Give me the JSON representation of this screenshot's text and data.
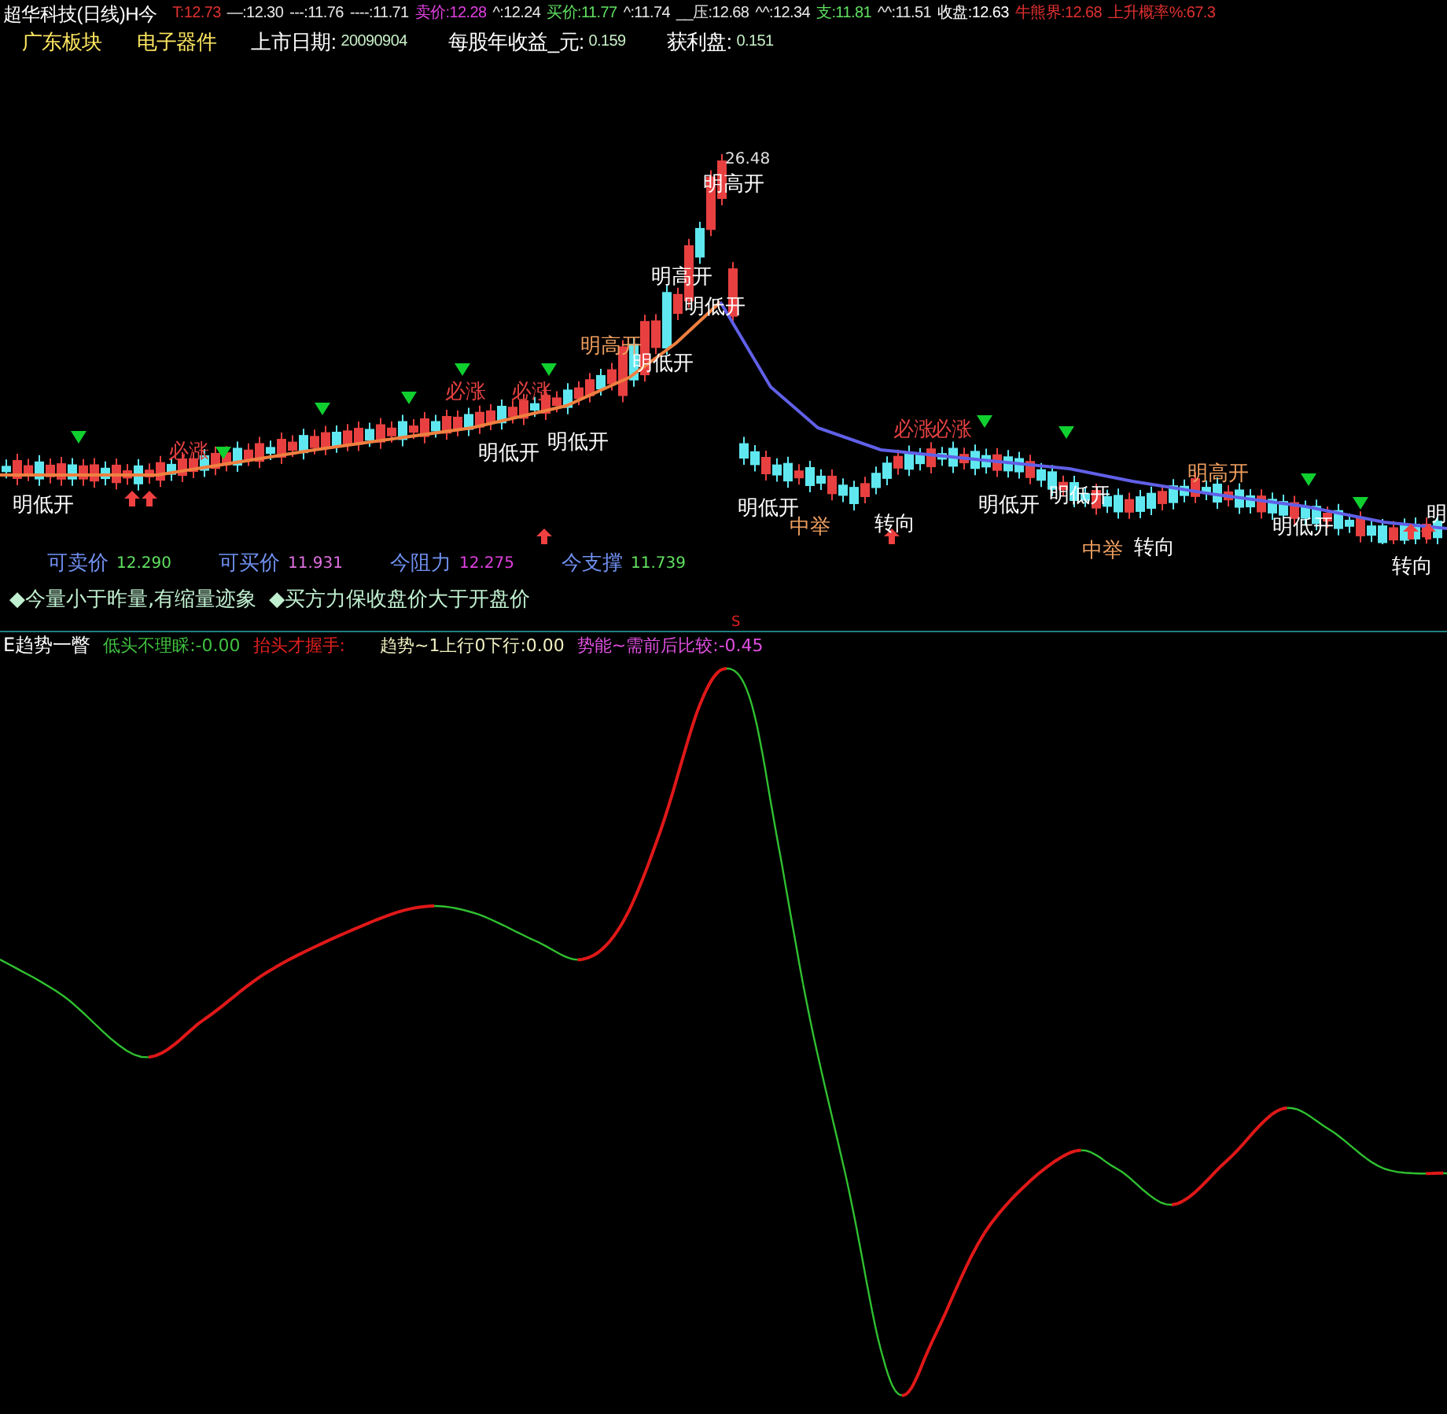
{
  "quote_bar": {
    "title": "超华科技(日线)H今",
    "items": [
      {
        "text": "T:12.73",
        "color": "#e03030"
      },
      {
        "text": "—:12.30",
        "color": "#e8e8e8"
      },
      {
        "text": "---:11.76",
        "color": "#e8e8e8"
      },
      {
        "text": "----:11.71",
        "color": "#e8e8e8"
      },
      {
        "text": "卖价:12.28",
        "color": "#e040e0"
      },
      {
        "text": "^:12.24",
        "color": "#e8e8e8"
      },
      {
        "text": "买价:11.77",
        "color": "#60e060"
      },
      {
        "text": "^:11.74",
        "color": "#e8e8e8"
      },
      {
        "text": "__压:12.68",
        "color": "#e8e8e8"
      },
      {
        "text": "^^:12.34",
        "color": "#e8e8e8"
      },
      {
        "text": "支:11.81",
        "color": "#60e060"
      },
      {
        "text": "^^:11.51",
        "color": "#e8e8e8"
      },
      {
        "text": "收盘:12.63",
        "color": "#ffffff"
      },
      {
        "text": "牛熊界:12.68",
        "color": "#e03030"
      },
      {
        "text": "上升概率%:67.3",
        "color": "#e03030"
      }
    ]
  },
  "info_bar": [
    {
      "label": "广东板块"
    },
    {
      "label": "电子器件"
    },
    {
      "label": "上市日期:",
      "value": "20090904"
    },
    {
      "label": "每股年收益_元:",
      "value": "0.159"
    },
    {
      "label": "获利盘:",
      "value": "0.151"
    }
  ],
  "chart_labels": [
    {
      "text": "26.48",
      "kind": "price"
    },
    {
      "text": "明高开",
      "kind": "signal"
    },
    {
      "text": "明高开",
      "kind": "signal"
    },
    {
      "text": "明低开",
      "kind": "signal"
    },
    {
      "text": "明高开",
      "kind": "warm"
    },
    {
      "text": "明低开",
      "kind": "signal"
    },
    {
      "text": "必涨",
      "kind": "rise"
    },
    {
      "text": "必涨",
      "kind": "rise"
    },
    {
      "text": "必涨",
      "kind": "rise"
    },
    {
      "text": "明低开",
      "kind": "signal"
    },
    {
      "text": "明低开",
      "kind": "signal"
    },
    {
      "text": "明低开",
      "kind": "signal"
    },
    {
      "text": "明低开",
      "kind": "signal"
    },
    {
      "text": "中举",
      "kind": "warm"
    },
    {
      "text": "转向",
      "kind": "signal"
    },
    {
      "text": "必涨",
      "kind": "rise"
    },
    {
      "text": "必涨",
      "kind": "rise"
    },
    {
      "text": "明低开",
      "kind": "signal"
    },
    {
      "text": "明低开",
      "kind": "signal"
    },
    {
      "text": "明高开",
      "kind": "warm"
    },
    {
      "text": "中举",
      "kind": "warm"
    },
    {
      "text": "转向",
      "kind": "signal"
    },
    {
      "text": "明低开",
      "kind": "signal"
    },
    {
      "text": "转向",
      "kind": "signal"
    },
    {
      "text": "明",
      "kind": "signal"
    }
  ],
  "price_levels": [
    {
      "label": "可卖价",
      "value": "12.290",
      "color": "#60e060"
    },
    {
      "label": "可买价",
      "value": "11.931",
      "color": "#e070e0"
    },
    {
      "label": "今阻力",
      "value": "12.275",
      "color": "#e040e0"
    },
    {
      "label": "今支撑",
      "value": "11.739",
      "color": "#60e060"
    }
  ],
  "notes": [
    "◆今量小于昨量,有缩量迹象",
    "◆买方力保收盘价大于开盘价"
  ],
  "signal_marker": "S",
  "indicator": {
    "title": "E趋势一瞥",
    "items": [
      {
        "text": "低头不理睬:-0.00",
        "color": "#40c040"
      },
      {
        "text": "抬头才握手:",
        "color": "#e02020"
      },
      {
        "text": "趋势~1上行0下行:0.00",
        "color": "#f0f0c0"
      },
      {
        "text": "势能~需前后比较:-0.45",
        "color": "#e050e0"
      }
    ]
  }
}
